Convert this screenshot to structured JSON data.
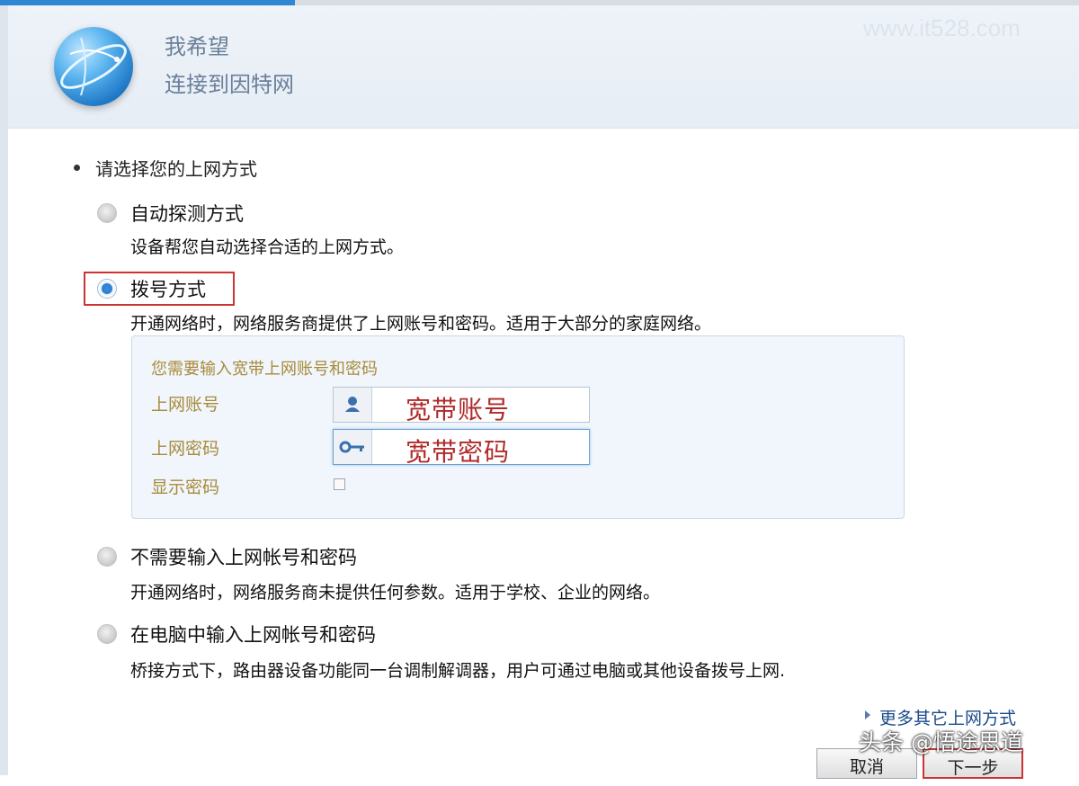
{
  "header": {
    "title": "我希望",
    "subtitle": "连接到因特网",
    "watermark": "www.it528.com"
  },
  "section": {
    "title": "请选择您的上网方式"
  },
  "options": [
    {
      "label": "自动探测方式",
      "desc": "设备帮您自动选择合适的上网方式。",
      "selected": false
    },
    {
      "label": "拨号方式",
      "desc": "开通网络时，网络服务商提供了上网账号和密码。适用于大部分的家庭网络。",
      "selected": true
    },
    {
      "label": "不需要输入上网帐号和密码",
      "desc": "开通网络时，网络服务商未提供任何参数。适用于学校、企业的网络。",
      "selected": false
    },
    {
      "label": "在电脑中输入上网帐号和密码",
      "desc": "桥接方式下，路由器设备功能同一台调制解调器，用户可通过电脑或其他设备拨号上网.",
      "selected": false
    }
  ],
  "panel": {
    "title": "您需要输入宽带上网账号和密码",
    "account_label": "上网账号",
    "account_value": "宽带账号",
    "password_label": "上网密码",
    "password_value": "宽带密码",
    "show_password_label": "显示密码",
    "show_password_checked": false
  },
  "footer": {
    "more_link": "更多其它上网方式",
    "cancel_label": "取消",
    "next_label": "下一步",
    "credit": "头条 @悟途思道"
  },
  "colors": {
    "accent": "#2f86d3",
    "highlight_box": "#cc3333",
    "handwritten": "#b02a2a"
  }
}
